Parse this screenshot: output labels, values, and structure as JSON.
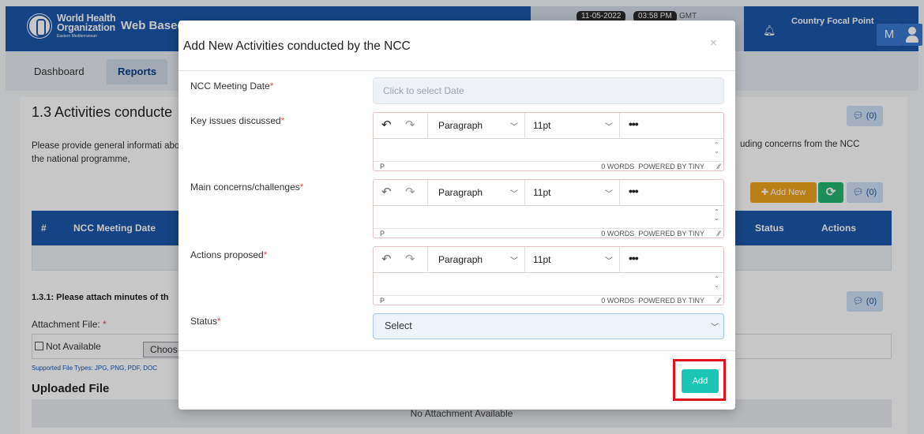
{
  "header": {
    "org_line1": "World Health",
    "org_line2": "Organization",
    "org_sub": "Eastern Mediterranean",
    "app_title": "Web Based",
    "date": "11-05-2022",
    "time": "03:58 PM",
    "timezone": "GMT",
    "role": "Country Focal Point",
    "avatar_initial": "M"
  },
  "nav": {
    "tabs": [
      "Dashboard",
      "Reports"
    ]
  },
  "section": {
    "title": "1.3 Activities conducte",
    "desc_left": "Please provide general informati about the national programme,",
    "desc_right": "uding concerns from the NCC",
    "comment_count": "(0)",
    "add_new_label": "Add New",
    "table_headers": [
      "#",
      "NCC Meeting Date",
      "Status",
      "Actions"
    ],
    "sub_heading": "1.3.1: Please attach minutes of th",
    "attachment_label": "Attachment File:",
    "attachment_req": "*",
    "not_available_label": "Not Available",
    "choose_label": "Choos",
    "supported_types": "Supported File Types: JPG, PNG, PDF, DOC",
    "uploaded_title": "Uploaded File",
    "no_attachment": "No Attachment Available"
  },
  "modal": {
    "title": "Add New Activities conducted by the NCC",
    "close": "×",
    "required_mark": "*",
    "date_field": {
      "label": "NCC Meeting Date",
      "placeholder": "Click to select Date"
    },
    "editors": [
      {
        "label": "Key issues discussed"
      },
      {
        "label": "Main concerns/challenges"
      },
      {
        "label": "Actions proposed"
      }
    ],
    "editor_toolbar": {
      "block": "Paragraph",
      "size": "11pt",
      "more": "•••"
    },
    "editor_status": {
      "path": "P",
      "words": "0 WORDS",
      "powered": "POWERED BY TINY"
    },
    "status_field": {
      "label": "Status",
      "value": "Select"
    },
    "add_label": "Add"
  },
  "icons": {
    "bell": "bell-icon",
    "user": "user-icon",
    "comment": "comment-icon",
    "plus": "plus-icon",
    "refresh": "refresh-icon",
    "undo": "undo-icon",
    "redo": "redo-icon",
    "chevron": "chevron-down-icon",
    "close": "close-icon"
  },
  "colors": {
    "brand_blue": "#1b56a8",
    "add_teal": "#1cc6b4",
    "add_new_orange": "#f0a31e",
    "refresh_green": "#22b573",
    "highlight_red": "#e0121b",
    "required_red": "#d9534f"
  }
}
